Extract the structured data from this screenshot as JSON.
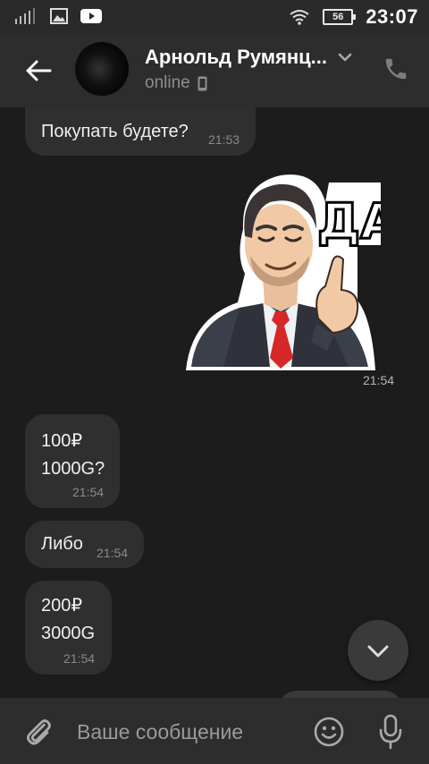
{
  "status_bar": {
    "time": "23:07",
    "battery": "56",
    "icons": [
      "signal-icon",
      "gallery-icon",
      "youtube-icon",
      "wifi-icon",
      "battery-icon"
    ]
  },
  "header": {
    "contact_name": "Арнольд Румянц...",
    "status": "online",
    "icons": [
      "back-arrow-icon",
      "chevron-down-icon",
      "mobile-device-icon",
      "phone-icon"
    ]
  },
  "messages": [
    {
      "text": "Покупать будете?",
      "time": "21:53"
    },
    {
      "sticker_caption": "ДА",
      "time": "21:54"
    },
    {
      "line1": "100₽",
      "line2": "1000G?",
      "time": "21:54"
    },
    {
      "text": "Либо",
      "time": "21:54"
    },
    {
      "line1": "200₽",
      "line2": "3000G",
      "time": "21:54"
    }
  ],
  "input_bar": {
    "placeholder": "Ваше сообщение",
    "icons": [
      "attach-icon",
      "emoji-icon",
      "microphone-icon"
    ]
  },
  "colors": {
    "background": "#1c1c1c",
    "bar": "#2d2d2d",
    "bubble": "#2f2f2f",
    "secondary_text": "#8a8a8a",
    "tie_red": "#d62828"
  }
}
